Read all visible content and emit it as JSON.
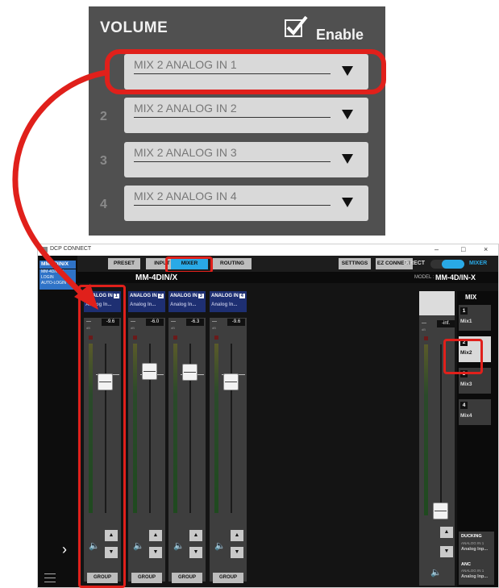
{
  "volume": {
    "title": "VOLUME",
    "enable_label": "Enable",
    "enable_checked": true,
    "rows": [
      {
        "num": "",
        "source": "MIX 2 ANALOG IN 1"
      },
      {
        "num": "2",
        "source": "MIX 2 ANALOG IN 2"
      },
      {
        "num": "3",
        "source": "MIX 2 ANALOG IN 3"
      },
      {
        "num": "4",
        "source": "MIX 2 ANALOG IN 4"
      }
    ]
  },
  "window": {
    "title": "DCP CONNECT",
    "minimize": "–",
    "maximize": "□",
    "close": "×"
  },
  "sidebar": {
    "active_device": "MM-4DIN/X",
    "info_line1": "MM-4D/IN-X",
    "info_line2": "LOGIN",
    "info_line3": "AUTO-LOGIN",
    "arrow": "›"
  },
  "nav": {
    "preset": "PRESET",
    "input": "INPUT",
    "mixer": "MIXER",
    "routing": "ROUTING",
    "settings": "SETTINGS",
    "ez_connect": "EZ CONNECT",
    "direct": "DIRECT",
    "mode": "MIXER"
  },
  "model_bar": {
    "device_name": "MM-4DIN/X",
    "model_label": "MODEL :",
    "model_value": "MM-4D/IN-X"
  },
  "channels": [
    {
      "name": "ANALOG IN",
      "num": "1",
      "src": "Analog In...",
      "level": "---",
      "value": "-9.6",
      "db": "dB"
    },
    {
      "name": "ANALOG IN",
      "num": "2",
      "src": "Analog In...",
      "level": "---",
      "value": "-6.0",
      "db": "dB"
    },
    {
      "name": "ANALOG IN",
      "num": "3",
      "src": "Analog In...",
      "level": "---",
      "value": "-6.3",
      "db": "dB"
    },
    {
      "name": "ANALOG IN",
      "num": "4",
      "src": "Analog In...",
      "level": "---",
      "value": "-9.6",
      "db": "dB"
    }
  ],
  "fader_levels_db": [
    -9.6,
    -6.0,
    -6.3,
    -9.6
  ],
  "group_label": "GROUP",
  "step_up": "▲",
  "step_down": "▼",
  "speaker_icon": "🔈",
  "master": {
    "level": "---",
    "value": "-inf.",
    "db": "dB"
  },
  "mix": {
    "title": "MIX",
    "items": [
      {
        "num": "1",
        "name": "Mix1"
      },
      {
        "num": "2",
        "name": "Mix2"
      },
      {
        "num": "3",
        "name": "Mix3"
      },
      {
        "num": "4",
        "name": "Mix4"
      }
    ],
    "selected": "Mix2",
    "ducking_title": "DUCKING",
    "ducking_sub": "ANALOG IN 1",
    "ducking_val": "Analog Inp...",
    "anc_title": "ANC",
    "anc_sub": "ANALOG IN 1",
    "anc_val": "Analog Inp..."
  },
  "colors": {
    "accent": "#29a9e6",
    "highlight": "#e0201b",
    "channel_header": "#1e2f72"
  }
}
